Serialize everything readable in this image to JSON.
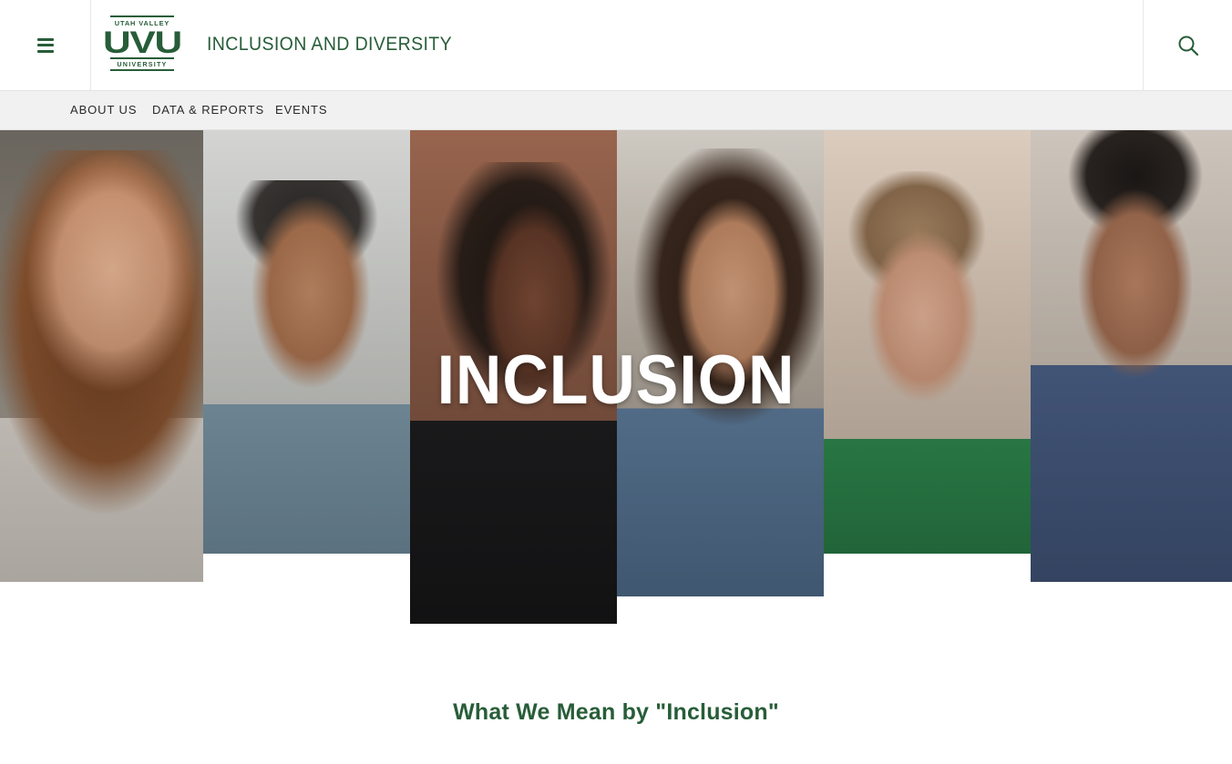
{
  "header": {
    "logo": {
      "top_text": "UTAH VALLEY",
      "mark": "UVU",
      "bottom_text": "UNIVERSITY"
    },
    "site_title": "INCLUSION AND DIVERSITY",
    "menu_icon": "hamburger-menu-icon",
    "search_icon": "search-icon"
  },
  "subnav": {
    "items": [
      {
        "label": "ABOUT US"
      },
      {
        "label": "DATA & REPORTS"
      },
      {
        "label": "EVENTS"
      }
    ]
  },
  "hero": {
    "headline": "INCLUSION"
  },
  "section": {
    "title": "What We Mean by \"Inclusion\""
  },
  "colors": {
    "brand_green": "#275d38",
    "nav_background": "#f1f1f1",
    "hero_text": "#ffffff"
  }
}
